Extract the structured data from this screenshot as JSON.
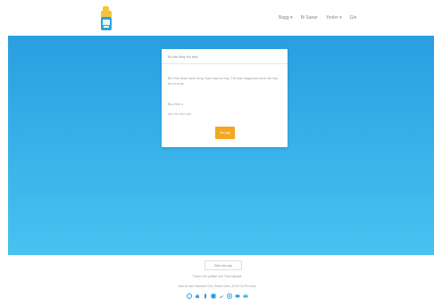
{
  "header": {
    "nav": [
      "Bagg ▾",
      "Bi Sanar",
      "Yonler ▾",
      "Gin"
    ],
    "logo_icon": "phone-bot-icon"
  },
  "card": {
    "title": "Bu the Bay Nu thai",
    "message": "Bir h'the tham lame th'ng, tham saa nui nay. The shin baganane ama, the hap the ni al an.",
    "label": "Bu p'lem a",
    "value": "ben the ban mar",
    "button_label": "Giri yap"
  },
  "footer": {
    "button_label": "Bize ula yap",
    "line1": "Tuner Gru yetkisi tum Tum bijmaal",
    "line2": "Nok is nam Tasarde Kat, Sinan Ozel; 2019 Ca Pro Ana",
    "social_icons": [
      "google-icon",
      "home-icon",
      "phone-icon",
      "facebook-icon",
      "twitter-icon",
      "instagram-icon",
      "youtube-icon",
      "mail-icon"
    ]
  },
  "colors": {
    "hero_top": "#2a9ee0",
    "hero_bottom": "#48c2ef",
    "accent": "#f5a623"
  }
}
